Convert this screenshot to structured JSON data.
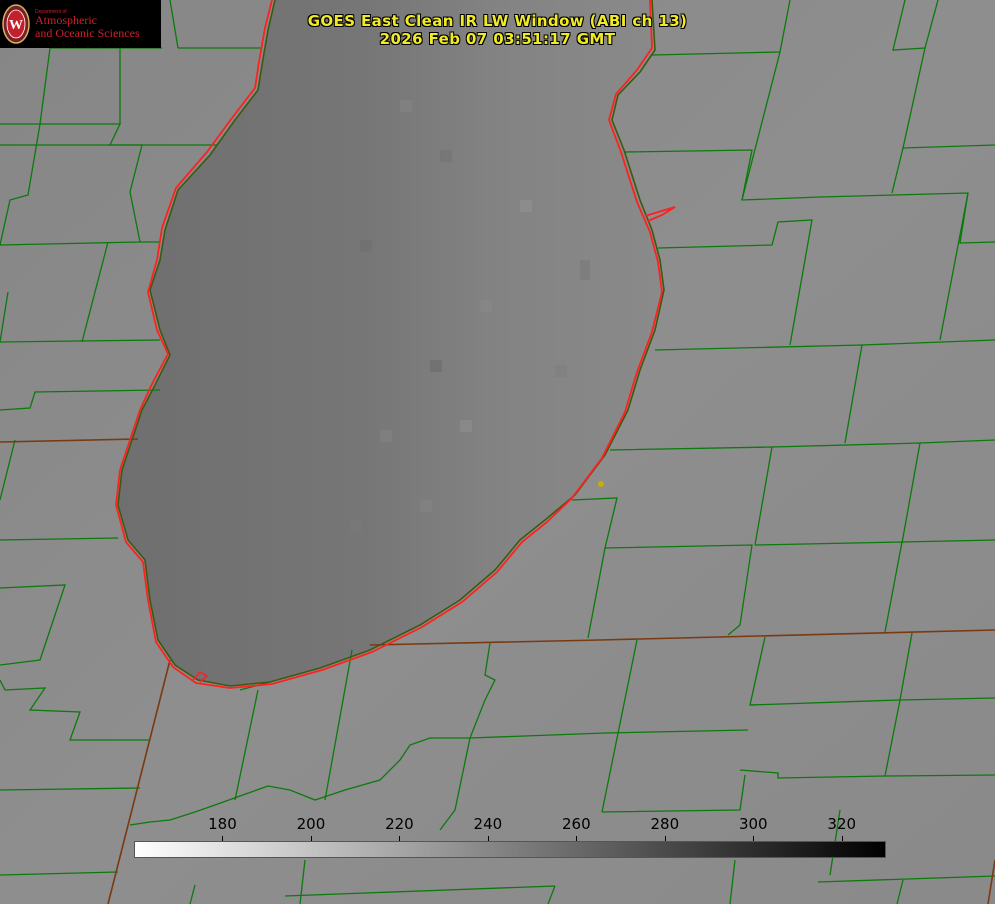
{
  "header": {
    "title_line1": "GOES East Clean IR LW Window (ABI ch 13)",
    "title_line2": "2026 Feb 07 03:51:17 GMT"
  },
  "logo": {
    "department": "Department of",
    "line1": "Atmospheric",
    "line2": "and Oceanic Sciences",
    "emblem_letter": "W"
  },
  "colorbar": {
    "min": 160,
    "max": 330,
    "ticks": [
      180,
      200,
      220,
      240,
      260,
      280,
      300,
      320
    ],
    "gradient": [
      "#ffffff",
      "#000000"
    ],
    "units": ""
  },
  "colors": {
    "land": "#8c8c8c",
    "lake": "#737373",
    "county_lines": "#0c7a0c",
    "state_lines": "#7a3a10",
    "shoreline": "#ff2020",
    "title": "#f0ea27",
    "marker": "#c8b000"
  },
  "map_layers": [
    "lake-michigan",
    "county-boundaries",
    "state-boundaries",
    "shoreline-outline",
    "station-marker"
  ]
}
